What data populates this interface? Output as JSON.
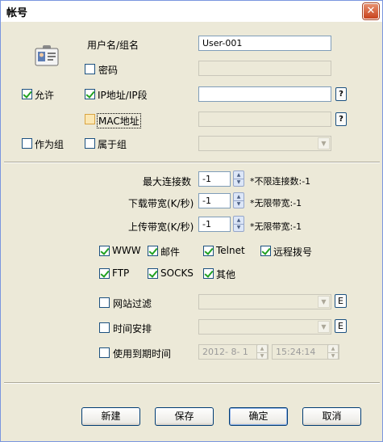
{
  "window": {
    "title": "帐号",
    "close_glyph": "✕"
  },
  "account": {
    "username_label": "用户名/组名",
    "username_value": "User-001",
    "password_label": "密码",
    "allow_label": "允许",
    "ip_label": "IP地址/IP段",
    "ip_value": "",
    "mac_label": "MAC地址",
    "as_group_label": "作为组",
    "belong_group_label": "属于组",
    "help_glyph": "?"
  },
  "limits": {
    "max_conn_label": "最大连接数",
    "max_conn_value": "-1",
    "max_conn_hint": "*不限连接数:-1",
    "download_label": "下载带宽(K/秒)",
    "download_value": "-1",
    "download_hint": "*无限带宽:-1",
    "upload_label": "上传带宽(K/秒)",
    "upload_value": "-1",
    "upload_hint": "*无限带宽:-1"
  },
  "services": [
    {
      "label": "WWW",
      "checked": true
    },
    {
      "label": "邮件",
      "checked": true
    },
    {
      "label": "Telnet",
      "checked": true
    },
    {
      "label": "远程拨号",
      "checked": true
    },
    {
      "label": "FTP",
      "checked": true
    },
    {
      "label": "SOCKS",
      "checked": true
    },
    {
      "label": "其他",
      "checked": true
    }
  ],
  "options": {
    "site_filter_label": "网站过滤",
    "schedule_label": "时间安排",
    "expiry_label": "使用到期时间",
    "expiry_date": "2012- 8- 1",
    "expiry_time": "15:24:14",
    "edit_glyph": "E"
  },
  "buttons": {
    "new": "新建",
    "save": "保存",
    "ok": "确定",
    "cancel": "取消"
  },
  "colors": {
    "check": "#21a121",
    "border": "#1c5180",
    "window_bg": "#ece9d8"
  }
}
